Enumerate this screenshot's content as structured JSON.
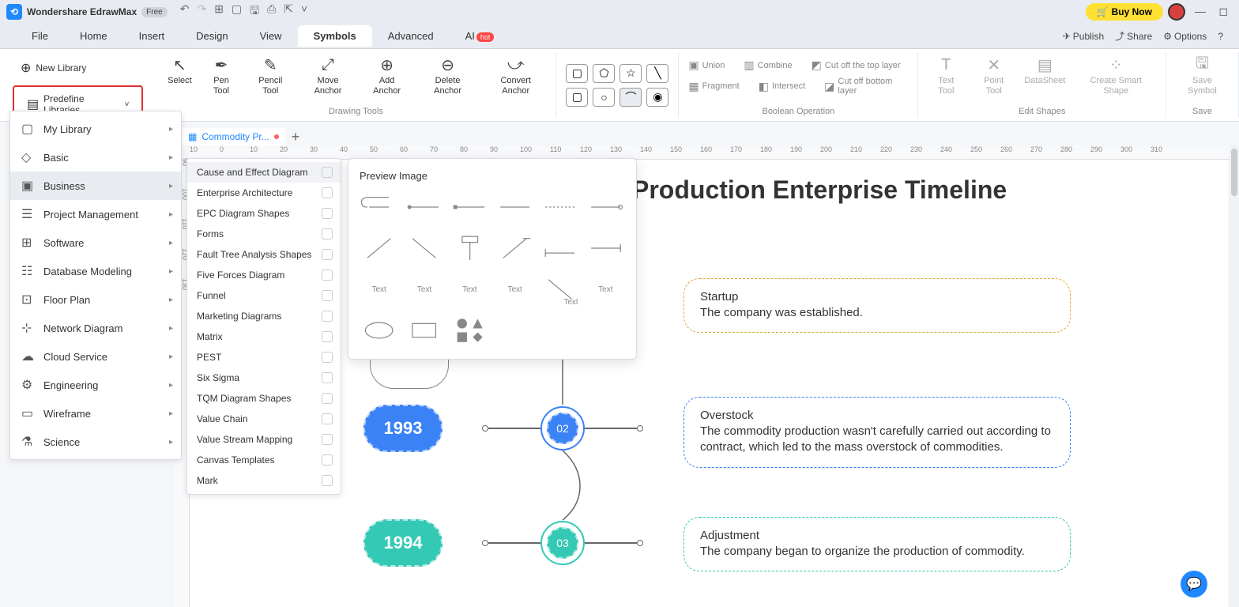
{
  "titlebar": {
    "appname": "Wondershare EdrawMax",
    "free_badge": "Free",
    "buynow": "Buy Now"
  },
  "menubar": {
    "items": [
      "File",
      "Home",
      "Insert",
      "Design",
      "View",
      "Symbols",
      "Advanced",
      "AI"
    ],
    "active": "Symbols",
    "hot_badge": "hot",
    "right": {
      "publish": "Publish",
      "share": "Share",
      "options": "Options"
    }
  },
  "ribbon": {
    "lib_new": "New Library",
    "lib_predef": "Predefine Libraries",
    "tools": [
      {
        "label": "Select"
      },
      {
        "label": "Pen Tool"
      },
      {
        "label": "Pencil Tool"
      },
      {
        "label": "Move Anchor"
      },
      {
        "label": "Add Anchor"
      },
      {
        "label": "Delete Anchor"
      },
      {
        "label": "Convert Anchor"
      }
    ],
    "group_drawing": "Drawing Tools",
    "bool_ops": {
      "union": "Union",
      "combine": "Combine",
      "cut_top": "Cut off the top layer",
      "fragment": "Fragment",
      "intersect": "Intersect",
      "cut_bottom": "Cut off bottom layer",
      "label": "Boolean Operation"
    },
    "edit_shapes": {
      "text_tool": "Text Tool",
      "point_tool": "Point Tool",
      "datasheet": "DataSheet",
      "smart_shape": "Create Smart Shape",
      "label": "Edit Shapes"
    },
    "save": {
      "save_symbol": "Save Symbol",
      "label": "Save"
    }
  },
  "submenu1": [
    {
      "label": "My Library"
    },
    {
      "label": "Basic"
    },
    {
      "label": "Business"
    },
    {
      "label": "Project Management"
    },
    {
      "label": "Software"
    },
    {
      "label": "Database Modeling"
    },
    {
      "label": "Floor Plan"
    },
    {
      "label": "Network Diagram"
    },
    {
      "label": "Cloud Service"
    },
    {
      "label": "Engineering"
    },
    {
      "label": "Wireframe"
    },
    {
      "label": "Science"
    }
  ],
  "submenu2": [
    {
      "label": "Cause and Effect Diagram"
    },
    {
      "label": "Enterprise Architecture"
    },
    {
      "label": "EPC Diagram Shapes"
    },
    {
      "label": "Forms"
    },
    {
      "label": "Fault Tree Analysis Shapes"
    },
    {
      "label": "Five Forces Diagram"
    },
    {
      "label": "Funnel"
    },
    {
      "label": "Marketing Diagrams"
    },
    {
      "label": "Matrix"
    },
    {
      "label": "PEST"
    },
    {
      "label": "Six Sigma"
    },
    {
      "label": "TQM Diagram Shapes"
    },
    {
      "label": "Value Chain"
    },
    {
      "label": "Value Stream Mapping"
    },
    {
      "label": "Canvas Templates"
    },
    {
      "label": "Mark"
    }
  ],
  "preview": {
    "title": "Preview Image",
    "text_label": "Text"
  },
  "tab": {
    "name": "Commodity Pr..."
  },
  "canvas": {
    "title": "Production Enterprise Timeline",
    "nodes": [
      {
        "year": "1993",
        "num": "02",
        "color": "#3b82f6",
        "title": "Overstock",
        "desc": "The commodity production wasn't carefully carried out according to contract, which led to the mass overstock of commodities."
      },
      {
        "year": "1994",
        "num": "03",
        "color": "#34c9b5",
        "title": "Adjustment",
        "desc": "The company began to organize the production of commodity."
      }
    ],
    "first": {
      "title": "Startup",
      "desc": "The company was established.",
      "color": "#e0a838"
    }
  },
  "ruler_h": [
    "10",
    "0",
    "10",
    "20",
    "30",
    "40",
    "50",
    "60",
    "70",
    "80",
    "90",
    "100",
    "110",
    "120",
    "130",
    "140",
    "150",
    "160",
    "170",
    "180",
    "190",
    "200",
    "210",
    "220",
    "230",
    "240",
    "250",
    "260",
    "270",
    "280",
    "290",
    "300",
    "310"
  ],
  "ruler_v": [
    "90",
    "100",
    "110",
    "120",
    "130"
  ]
}
